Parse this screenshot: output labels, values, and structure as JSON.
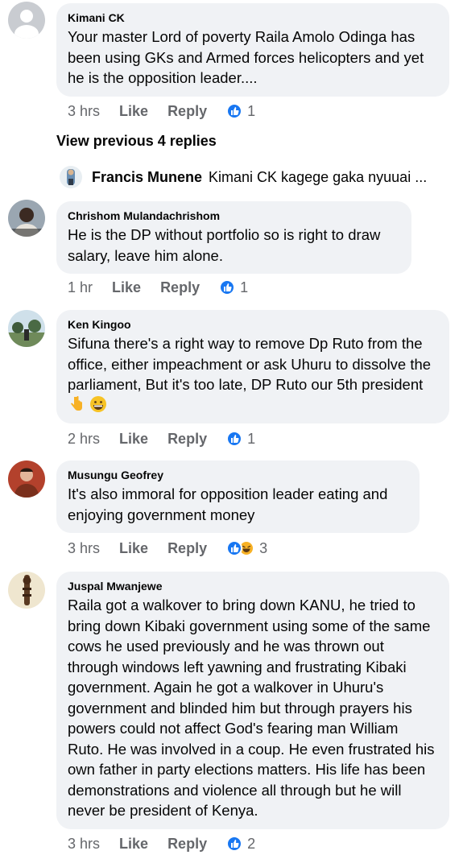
{
  "comments": [
    {
      "author": "Kimani CK",
      "text": "Your master Lord of poverty Raila Amolo Odinga has been using GKs and Armed forces helicopters and yet he is the opposition leader....",
      "time": "3 hrs",
      "like": "Like",
      "reply": "Reply",
      "reaction_count": "1"
    },
    {
      "author": "Chrishom Mulandachrishom",
      "text": "He is the DP without portfolio so is right to draw salary, leave him alone.",
      "time": "1 hr",
      "like": "Like",
      "reply": "Reply",
      "reaction_count": "1"
    },
    {
      "author": "Ken Kingoo",
      "text": "Sifuna there's a right way to remove Dp Ruto from the office, either impeachment or ask Uhuru to dissolve the parliament, But it's too late, DP Ruto our 5th president",
      "time": "2 hrs",
      "like": "Like",
      "reply": "Reply",
      "reaction_count": "1"
    },
    {
      "author": "Musungu Geofrey",
      "text": "It's also immoral for opposition leader eating and enjoying government money",
      "time": "3 hrs",
      "like": "Like",
      "reply": "Reply",
      "reaction_count": "3"
    },
    {
      "author": "Juspal Mwanjewe",
      "text": "Raila got a walkover to bring down KANU, he tried to bring down Kibaki government using some of the same cows he used previously and he was thrown out through windows left yawning and frustrating Kibaki government. Again he got a walkover in Uhuru's government and blinded him but through prayers his powers could not affect God's fearing man William Ruto. He was involved in a coup. He even frustrated his own father in party elections matters. His life has been demonstrations and violence all through but he will never be president of Kenya.",
      "time": "3 hrs",
      "like": "Like",
      "reply": "Reply",
      "reaction_count": "2"
    }
  ],
  "view_previous": "View previous 4 replies",
  "reply_preview": {
    "name": "Francis Munene",
    "snippet": "Kimani CK kagege gaka nyuuai ..."
  },
  "colors": {
    "bubble": "#f0f2f5",
    "meta_text": "#65676b",
    "like_blue": "#1877f2",
    "haha_yellow": "#f7b125"
  }
}
